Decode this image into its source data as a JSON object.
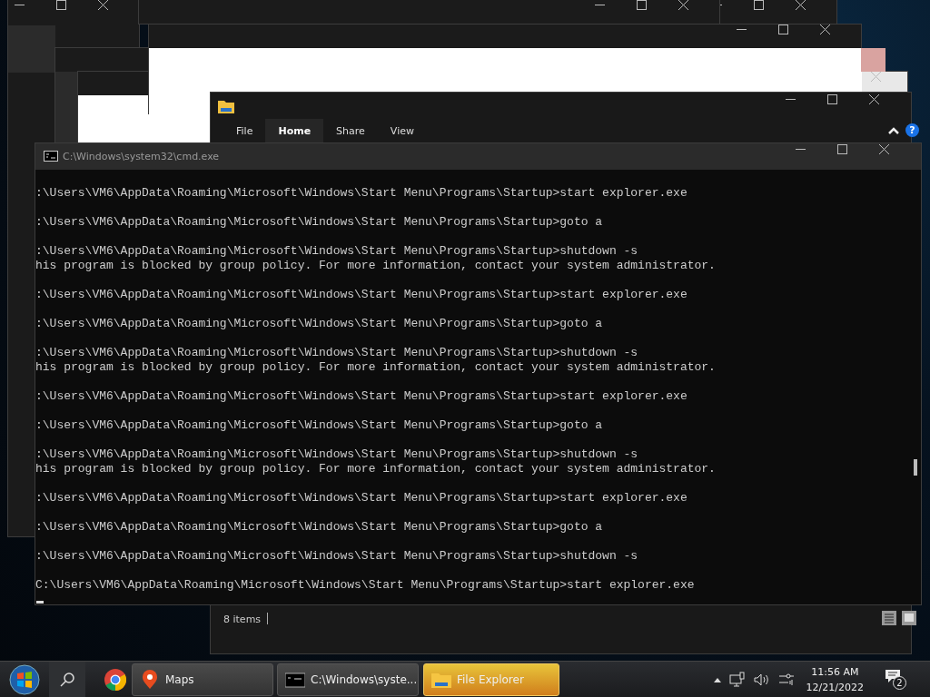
{
  "explorer": {
    "ribbon_tabs": [
      {
        "label": "File",
        "selected": false
      },
      {
        "label": "Home",
        "selected": true
      },
      {
        "label": "Share",
        "selected": false
      },
      {
        "label": "View",
        "selected": false
      }
    ],
    "status": "8 items",
    "help": "?"
  },
  "console": {
    "title": "C:\\Windows\\system32\\cmd.exe",
    "groups": [
      [
        ":\\Users\\VM6\\AppData\\Roaming\\Microsoft\\Windows\\Start Menu\\Programs\\Startup>start explorer.exe"
      ],
      [
        ":\\Users\\VM6\\AppData\\Roaming\\Microsoft\\Windows\\Start Menu\\Programs\\Startup>goto a"
      ],
      [
        ":\\Users\\VM6\\AppData\\Roaming\\Microsoft\\Windows\\Start Menu\\Programs\\Startup>shutdown -s",
        "his program is blocked by group policy. For more information, contact your system administrator."
      ],
      [
        ":\\Users\\VM6\\AppData\\Roaming\\Microsoft\\Windows\\Start Menu\\Programs\\Startup>start explorer.exe"
      ],
      [
        ":\\Users\\VM6\\AppData\\Roaming\\Microsoft\\Windows\\Start Menu\\Programs\\Startup>goto a"
      ],
      [
        ":\\Users\\VM6\\AppData\\Roaming\\Microsoft\\Windows\\Start Menu\\Programs\\Startup>shutdown -s",
        "his program is blocked by group policy. For more information, contact your system administrator."
      ],
      [
        ":\\Users\\VM6\\AppData\\Roaming\\Microsoft\\Windows\\Start Menu\\Programs\\Startup>start explorer.exe"
      ],
      [
        ":\\Users\\VM6\\AppData\\Roaming\\Microsoft\\Windows\\Start Menu\\Programs\\Startup>goto a"
      ],
      [
        ":\\Users\\VM6\\AppData\\Roaming\\Microsoft\\Windows\\Start Menu\\Programs\\Startup>shutdown -s",
        "his program is blocked by group policy. For more information, contact your system administrator."
      ],
      [
        ":\\Users\\VM6\\AppData\\Roaming\\Microsoft\\Windows\\Start Menu\\Programs\\Startup>start explorer.exe"
      ],
      [
        ":\\Users\\VM6\\AppData\\Roaming\\Microsoft\\Windows\\Start Menu\\Programs\\Startup>goto a"
      ],
      [
        ":\\Users\\VM6\\AppData\\Roaming\\Microsoft\\Windows\\Start Menu\\Programs\\Startup>shutdown -s"
      ],
      [
        "C:\\Users\\VM6\\AppData\\Roaming\\Microsoft\\Windows\\Start Menu\\Programs\\Startup>start explorer.exe"
      ]
    ]
  },
  "taskbar": {
    "buttons": [
      {
        "label": "Maps",
        "kind": "maps",
        "selected": false
      },
      {
        "label": "C:\\Windows\\syste...",
        "kind": "console",
        "selected": false
      },
      {
        "label": "File Explorer",
        "kind": "explorer",
        "selected": true
      }
    ],
    "time": "11:56 AM",
    "date": "12/21/2022",
    "notifications": "2"
  }
}
